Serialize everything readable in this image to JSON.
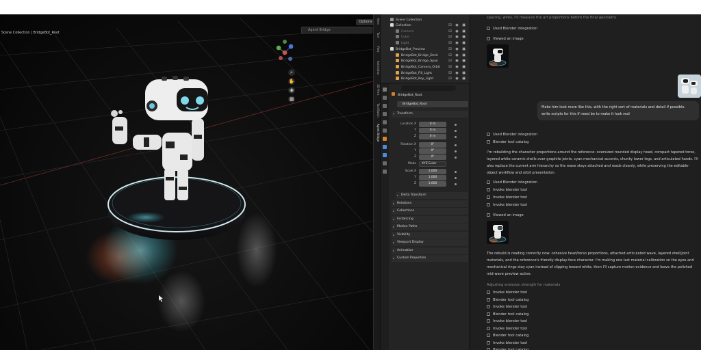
{
  "viewport": {
    "collection_path": "Scene Collection | BridgeBot_Root",
    "options_label": "Options",
    "search_placeholder": "Agent Bridge",
    "n_panel_tabs": [
      "Item",
      "Tool",
      "View",
      "Animation",
      "3D-Print",
      "Tool Batch",
      "Agent Bridge"
    ]
  },
  "outliner": {
    "title": "Scene Collection",
    "items": [
      {
        "label": "Collection",
        "dim": false,
        "color": "#d8d8d8"
      },
      {
        "label": "Camera",
        "dim": true,
        "color": "#7a7a7a"
      },
      {
        "label": "Cube",
        "dim": true,
        "color": "#7a7a7a"
      },
      {
        "label": "Light",
        "dim": true,
        "color": "#7a7a7a"
      },
      {
        "label": "BridgeBot_Preview",
        "dim": false,
        "color": "#d8d8d8"
      },
      {
        "label": "BridgeBot_Bridge_Deck",
        "dim": false,
        "color": "#e0a24a"
      },
      {
        "label": "BridgeBot_Bridge_Span",
        "dim": false,
        "color": "#e0a24a"
      },
      {
        "label": "BridgeBot_Camera_Orbit",
        "dim": false,
        "color": "#e0a24a"
      },
      {
        "label": "BridgeBot_Fill_Light",
        "dim": false,
        "color": "#e0a24a"
      },
      {
        "label": "BridgeBot_Key_Light",
        "dim": false,
        "color": "#e0a24a"
      }
    ]
  },
  "properties": {
    "object_name": "BridgeBot_Root",
    "object_field": "BridgeBot_Root",
    "transform_header": "Transform",
    "location": {
      "label": "Location X",
      "values": [
        "0 m",
        "0 m",
        "0 m"
      ]
    },
    "rotation": {
      "label": "Rotation X",
      "values": [
        "0°",
        "0°",
        "0°"
      ]
    },
    "mode": {
      "label": "Mode",
      "value": "XYZ Euler"
    },
    "scale": {
      "label": "Scale X",
      "values": [
        "1.000",
        "1.000",
        "1.000"
      ]
    },
    "axis_labels": [
      "Y",
      "Z"
    ],
    "panels": [
      "Delta Transform",
      "Relations",
      "Collections",
      "Instancing",
      "Motion Paths",
      "Visibility",
      "Viewport Display",
      "Animation",
      "Custom Properties"
    ]
  },
  "chat": {
    "top_fade": "spacing, wires, I'll measure the art proportions before the final geometry.",
    "used_integration_1": "Used Blender integration",
    "viewed_image_1": "Viewed an image",
    "user_message": "Make him look more like this, with the right sort of materials and detail if possible. write scripts for this if need be to make it look real",
    "used_integration_2": "Used Blender integration",
    "tool_catalog_1": "Blender tool catalog",
    "para_1": "I'm rebuilding the character proportions around the reference: oversized rounded display head, compact tapered torso, layered white ceramic shells over graphite joints, cyan mechanical accents, chunky lower legs, and articulated hands. I'll also replace the current arm hierarchy so the wave stays attached and reads cleanly, while preserving the editable-object workflow and orbit presentation.",
    "used_integration_3": "Used Blender integration",
    "invoke_1": "Invoke blender tool",
    "invoke_2": "Invoke blender tool",
    "invoke_3": "Invoke blender tool",
    "viewed_image_2": "Viewed an image",
    "para_2": "The rebuild is reading correctly now: cohesive head/torso proportions, attached articulated wave, layered shell/joint materials, and the reference's friendly display-face character. I'm making one last material calibration so the eyes and mechanical rings stay cyan instead of clipping toward white, then I'll capture motion evidence and leave the polished mid-wave preview active.",
    "adjusting": "Adjusting emission strength for materials",
    "log": [
      "Invoke blender tool",
      "Blender tool catalog",
      "Invoke blender tool",
      "Blender tool catalog",
      "Invoke blender tool",
      "Invoke blender tool",
      "Blender tool catalog",
      "Invoke blender tool",
      "Blender tool catalog"
    ]
  },
  "colors": {
    "accent_cyan": "#35d0e6",
    "panel_bg": "#242424",
    "chat_bg": "#1f1f1f",
    "object_orange": "#e0a24a"
  }
}
